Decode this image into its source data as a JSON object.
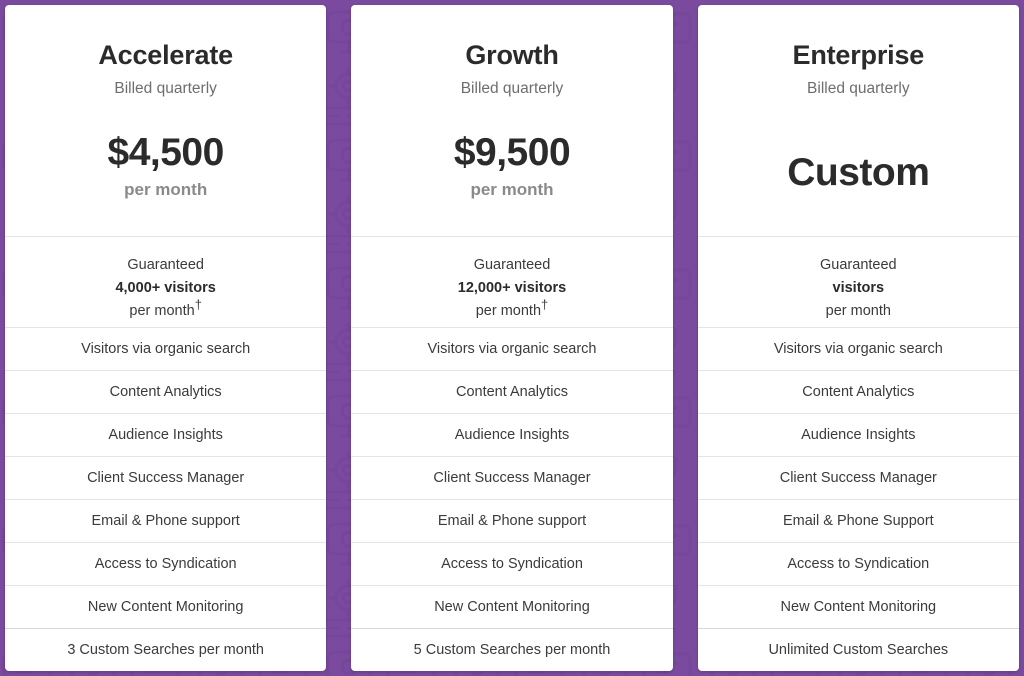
{
  "theme": {
    "background_purple": "#7a4a9e",
    "pattern_purple": "#6f4193",
    "card_background": "#ffffff",
    "heading_color": "#2b2b2b",
    "muted_text_color": "#6e6e6e",
    "body_text_color": "#3b3b3b",
    "divider_color": "#e4e4e4"
  },
  "plans": [
    {
      "name": "Accelerate",
      "billing": "Billed quarterly",
      "price": "$4,500",
      "price_unit": "per month",
      "price_unit_visible": true,
      "guarantee": {
        "line1": "Guaranteed",
        "line2": "4,000+ visitors",
        "line3": "per month",
        "dagger": "†"
      },
      "features": [
        "Visitors via organic search",
        "Content Analytics",
        "Audience Insights",
        "Client Success Manager",
        "Email & Phone support",
        "Access to Syndication",
        "New Content Monitoring",
        "3 Custom Searches per month"
      ]
    },
    {
      "name": "Growth",
      "billing": "Billed quarterly",
      "price": "$9,500",
      "price_unit": "per month",
      "price_unit_visible": true,
      "guarantee": {
        "line1": "Guaranteed",
        "line2": "12,000+ visitors",
        "line3": "per month",
        "dagger": "†"
      },
      "features": [
        "Visitors via organic search",
        "Content Analytics",
        "Audience Insights",
        "Client Success Manager",
        "Email & Phone support",
        "Access to Syndication",
        "New Content Monitoring",
        "5 Custom Searches per month"
      ]
    },
    {
      "name": "Enterprise",
      "billing": "Billed quarterly",
      "price": "Custom",
      "price_unit": "",
      "price_unit_visible": false,
      "guarantee": {
        "line1": "Guaranteed",
        "line2": "visitors",
        "line3": "per month",
        "dagger": ""
      },
      "features": [
        "Visitors via organic search",
        "Content Analytics",
        "Audience Insights",
        "Client Success Manager",
        "Email & Phone Support",
        "Access to Syndication",
        "New Content Monitoring",
        "Unlimited Custom Searches"
      ]
    }
  ]
}
